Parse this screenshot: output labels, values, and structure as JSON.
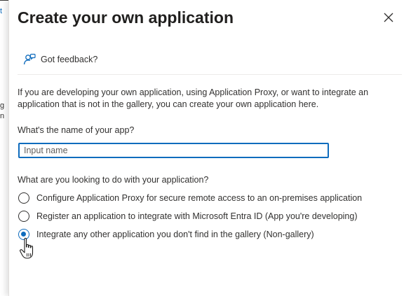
{
  "underlay": {
    "fragments": [
      "t",
      "g",
      "n"
    ]
  },
  "panel": {
    "title": "Create your own application",
    "close_icon": "close-icon",
    "feedback": {
      "icon": "feedback-person-icon",
      "label": "Got feedback?"
    },
    "description": "If you are developing your own application, using Application Proxy, or want to integrate an application that is not in the gallery, you can create your own application here.",
    "name_field": {
      "label": "What's the name of your app?",
      "placeholder": "Input name",
      "value": ""
    },
    "purpose": {
      "label": "What are you looking to do with your application?",
      "options": [
        {
          "label": "Configure Application Proxy for secure remote access to an on-premises application",
          "selected": false
        },
        {
          "label": "Register an application to integrate with Microsoft Entra ID (App you're developing)",
          "selected": false
        },
        {
          "label": "Integrate any other application you don't find in the gallery (Non-gallery)",
          "selected": true
        }
      ]
    }
  },
  "colors": {
    "accent": "#0f6cbd",
    "text": "#323130",
    "title": "#201f1e"
  }
}
